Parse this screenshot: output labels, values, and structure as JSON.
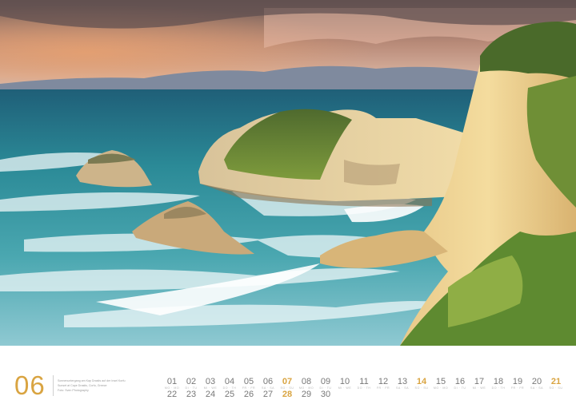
{
  "photo": {
    "description_icon": "landscape-photo-icon"
  },
  "calendar": {
    "month_number": "06",
    "caption": {
      "line1": "Sonnenuntergang am Kap Drastis auf der Insel Korfu",
      "line2": "Sunset at Cape Drastis, Corfu, Greece",
      "line3": "Foto: Sven Photography"
    },
    "accent_color": "#d9a441",
    "row1": [
      {
        "num": "01",
        "wd": "MO · MO",
        "hl": false
      },
      {
        "num": "02",
        "wd": "DI · TU",
        "hl": false
      },
      {
        "num": "03",
        "wd": "MI · WE",
        "hl": false
      },
      {
        "num": "04",
        "wd": "DO · TH",
        "hl": false
      },
      {
        "num": "05",
        "wd": "FR · FR",
        "hl": false
      },
      {
        "num": "06",
        "wd": "SA · SA",
        "hl": false
      },
      {
        "num": "07",
        "wd": "SO · SU",
        "hl": true
      },
      {
        "num": "08",
        "wd": "MO · MO",
        "hl": false
      },
      {
        "num": "09",
        "wd": "DI · TU",
        "hl": false
      },
      {
        "num": "10",
        "wd": "MI · WE",
        "hl": false
      },
      {
        "num": "11",
        "wd": "DO · TH",
        "hl": false
      },
      {
        "num": "12",
        "wd": "FR · FR",
        "hl": false
      },
      {
        "num": "13",
        "wd": "SA · SA",
        "hl": false
      },
      {
        "num": "14",
        "wd": "SO · SU",
        "hl": true
      },
      {
        "num": "15",
        "wd": "MO · MO",
        "hl": false
      },
      {
        "num": "16",
        "wd": "DI · TU",
        "hl": false
      },
      {
        "num": "17",
        "wd": "MI · WE",
        "hl": false
      },
      {
        "num": "18",
        "wd": "DO · TH",
        "hl": false
      },
      {
        "num": "19",
        "wd": "FR · FR",
        "hl": false
      },
      {
        "num": "20",
        "wd": "SA · SA",
        "hl": false
      },
      {
        "num": "21",
        "wd": "SO · SU",
        "hl": true
      }
    ],
    "row2": [
      {
        "num": "22",
        "wd": "MO · MO",
        "hl": false
      },
      {
        "num": "23",
        "wd": "DI · TU",
        "hl": false
      },
      {
        "num": "24",
        "wd": "MI · WE",
        "hl": false
      },
      {
        "num": "25",
        "wd": "DO · TH",
        "hl": false
      },
      {
        "num": "26",
        "wd": "FR · FR",
        "hl": false
      },
      {
        "num": "27",
        "wd": "SA · SA",
        "hl": false
      },
      {
        "num": "28",
        "wd": "SO · SU",
        "hl": true
      },
      {
        "num": "29",
        "wd": "MO · MO",
        "hl": false
      },
      {
        "num": "30",
        "wd": "DI · TU",
        "hl": false
      }
    ]
  }
}
